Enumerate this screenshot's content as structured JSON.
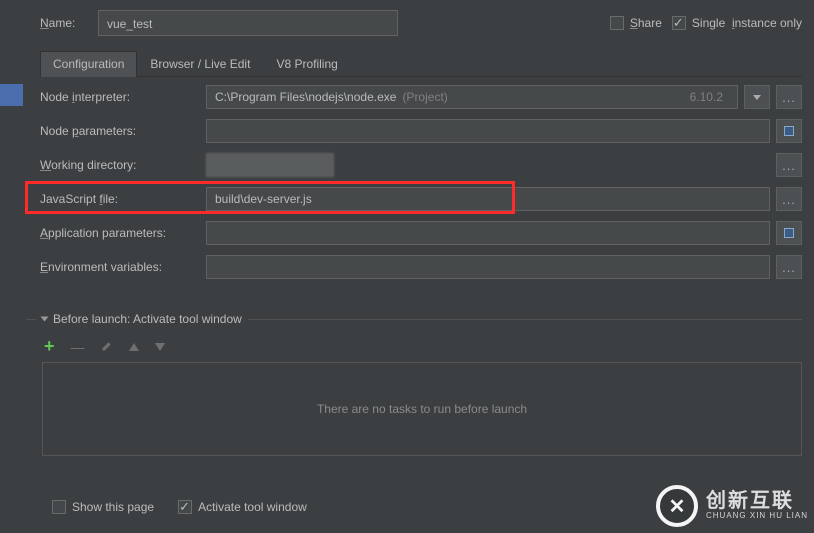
{
  "top": {
    "name_label": "Name:",
    "name_value": "vue_test",
    "share_label": "Share",
    "single_label": "Single instance only"
  },
  "tabs": {
    "config": "Configuration",
    "browser": "Browser / Live Edit",
    "v8": "V8 Profiling"
  },
  "form": {
    "node_interpreter_label": "Node interpreter:",
    "node_interpreter_value": "C:\\Program Files\\nodejs\\node.exe",
    "node_interpreter_suffix": "(Project)",
    "node_interpreter_version": "6.10.2",
    "node_parameters_label": "Node parameters:",
    "node_parameters_value": "",
    "working_dir_label": "Working directory:",
    "working_dir_value": "",
    "js_file_label": "JavaScript file:",
    "js_file_value": "build\\dev-server.js",
    "app_params_label": "Application parameters:",
    "app_params_value": "",
    "env_vars_label": "Environment variables:",
    "env_vars_value": ""
  },
  "before_launch": {
    "title": "Before launch: Activate tool window",
    "empty_text": "There are no tasks to run before launch"
  },
  "bottom": {
    "show_page": "Show this page",
    "activate_tool": "Activate tool window"
  },
  "watermark": {
    "cn": "创新互联",
    "en": "CHUANG XIN HU LIAN"
  }
}
